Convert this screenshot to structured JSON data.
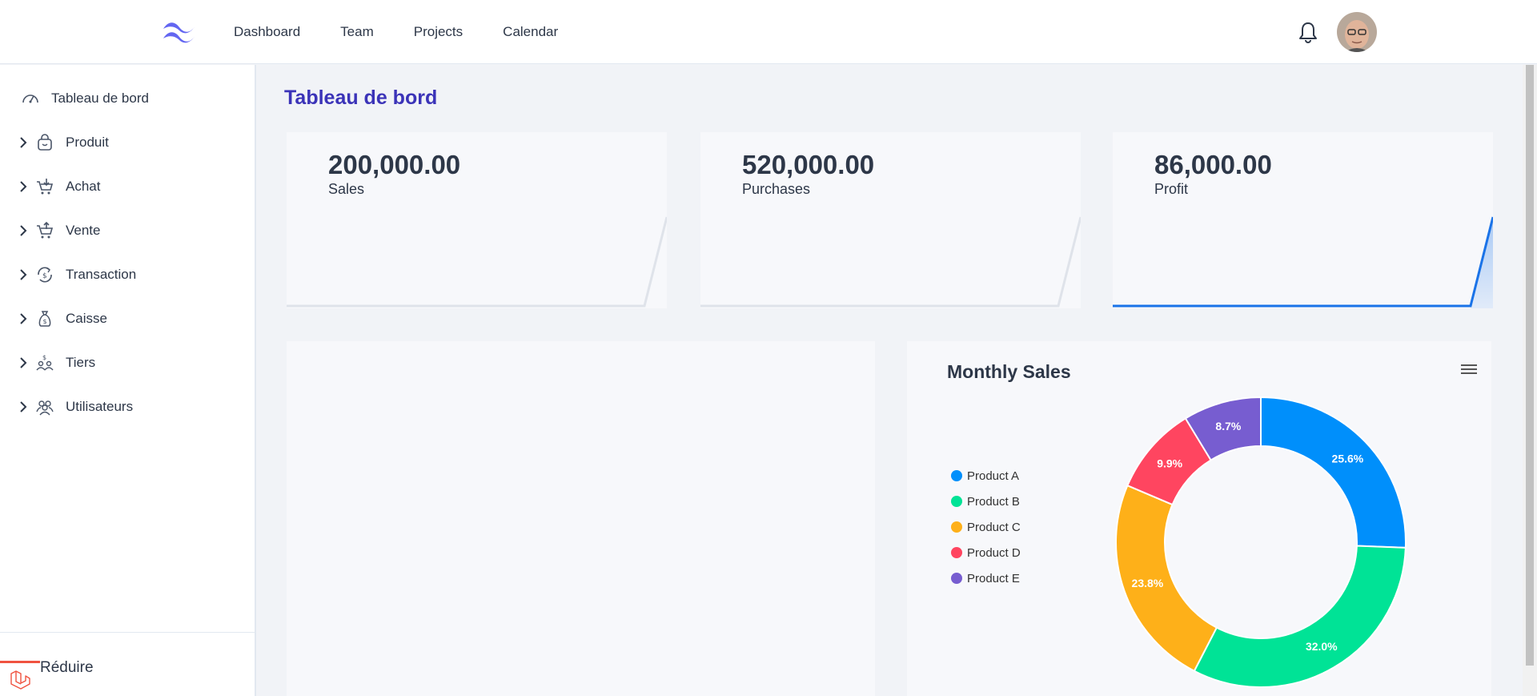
{
  "nav": {
    "links": [
      "Dashboard",
      "Team",
      "Projects",
      "Calendar"
    ]
  },
  "sidebar": {
    "items": [
      {
        "label": "Tableau de bord",
        "icon": "gauge-icon"
      },
      {
        "label": "Produit",
        "icon": "shopping-bag-icon"
      },
      {
        "label": "Achat",
        "icon": "cart-down-icon"
      },
      {
        "label": "Vente",
        "icon": "cart-up-icon"
      },
      {
        "label": "Transaction",
        "icon": "transaction-icon"
      },
      {
        "label": "Caisse",
        "icon": "money-bag-icon"
      },
      {
        "label": "Tiers",
        "icon": "people-dollar-icon"
      },
      {
        "label": "Utilisateurs",
        "icon": "users-icon"
      }
    ],
    "collapse_label": "Réduire"
  },
  "main": {
    "title": "Tableau de bord",
    "stats": [
      {
        "value": "200,000.00",
        "label": "Sales"
      },
      {
        "value": "520,000.00",
        "label": "Purchases"
      },
      {
        "value": "86,000.00",
        "label": "Profit"
      }
    ]
  },
  "colors": {
    "accent": "#3b33b8",
    "product_a": "#008ffb",
    "product_b": "#00e396",
    "product_c": "#feb019",
    "product_d": "#ff4560",
    "product_e": "#775dd0",
    "sparkline_profit": "#1a73e8"
  },
  "chart_data": {
    "type": "pie",
    "title": "Monthly Sales",
    "categories": [
      "Product A",
      "Product B",
      "Product C",
      "Product D",
      "Product E"
    ],
    "values": [
      25.6,
      32.0,
      23.8,
      9.9,
      8.7
    ],
    "labels": [
      "25.6%",
      "32.0%",
      "23.8%",
      "9.9%",
      "8.7%"
    ],
    "legend": "left",
    "donut": true
  }
}
